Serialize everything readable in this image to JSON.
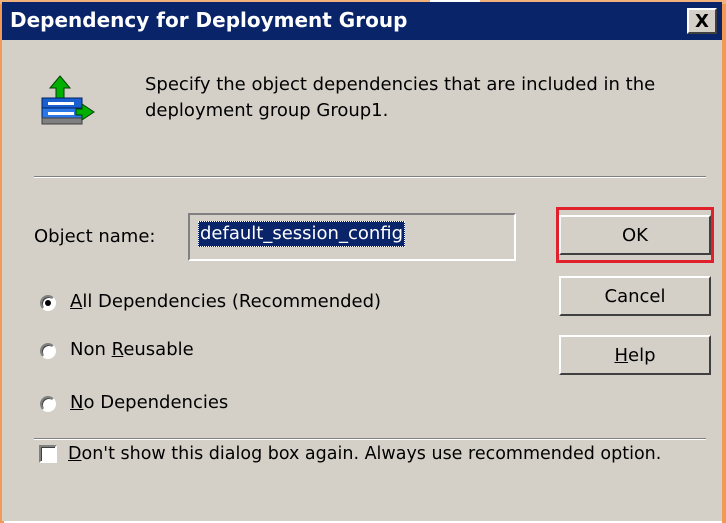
{
  "window": {
    "title": "Dependency for Deployment Group",
    "close_glyph": "X"
  },
  "header": {
    "icon": "deployment-group-icon",
    "description": "Specify the object dependencies that are included in the deployment group Group1."
  },
  "object_name": {
    "label_pre": "Ob",
    "label_ul": "j",
    "label_post": "ect name:",
    "value": "default_session_config"
  },
  "buttons": {
    "ok": "OK",
    "cancel": "Cancel",
    "help_ul": "H",
    "help_rest": "elp"
  },
  "dependency_options": [
    {
      "pre": "",
      "ul": "A",
      "post": "ll Dependencies (Recommended)",
      "selected": true
    },
    {
      "pre": "Non ",
      "ul": "R",
      "post": "eusable",
      "selected": false
    },
    {
      "pre": "",
      "ul": "N",
      "post": "o Dependencies",
      "selected": false
    }
  ],
  "dont_show": {
    "ul": "D",
    "rest": "on't show this dialog box again. Always use recommended option.",
    "checked": false
  },
  "colors": {
    "titlebar": "#0a246a",
    "dialog_bg": "#d4d0c8",
    "highlight": "#e0202a",
    "frame_accent": "#f29a55"
  }
}
